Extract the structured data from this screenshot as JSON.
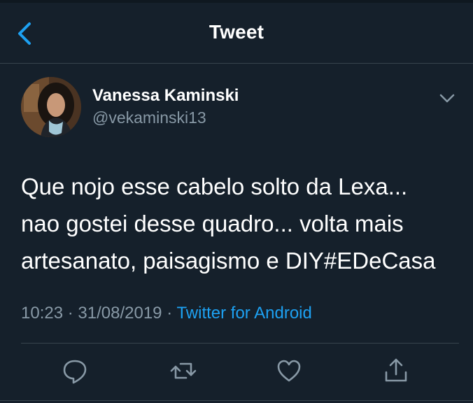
{
  "header": {
    "title": "Tweet",
    "back_icon": "chevron-left-icon"
  },
  "tweet": {
    "author": {
      "display_name": "Vanessa Kaminski",
      "handle": "@vekaminski13"
    },
    "text": "Que nojo esse cabelo solto da Lexa...\nnao gostei desse quadro... volta mais\nartesanato, paisagismo e DIY#EDeCasa",
    "time": "10:23",
    "date": "31/08/2019",
    "separator": "·",
    "source": "Twitter for Android"
  },
  "actions": {
    "icons": [
      "reply-icon",
      "retweet-icon",
      "like-icon",
      "share-icon"
    ]
  },
  "colors": {
    "background": "#15202b",
    "text_primary": "#ffffff",
    "text_secondary": "#8899a6",
    "accent": "#1da1f2",
    "border": "#38444d"
  }
}
